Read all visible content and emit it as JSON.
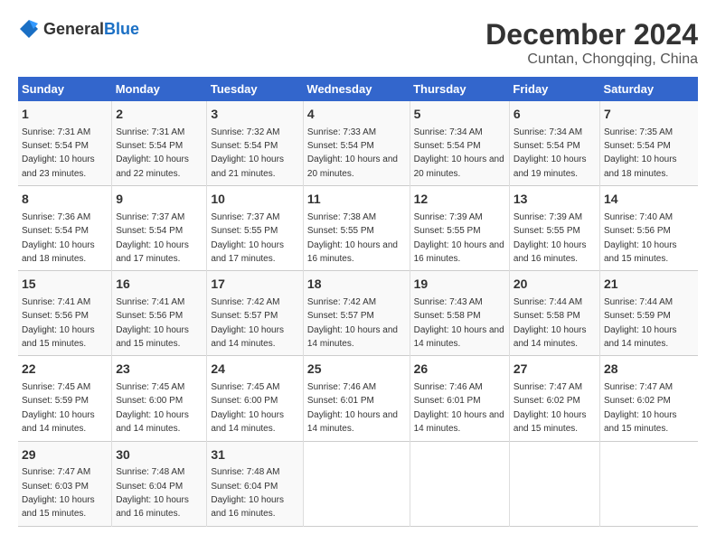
{
  "logo": {
    "general": "General",
    "blue": "Blue"
  },
  "title": "December 2024",
  "subtitle": "Cuntan, Chongqing, China",
  "weekdays": [
    "Sunday",
    "Monday",
    "Tuesday",
    "Wednesday",
    "Thursday",
    "Friday",
    "Saturday"
  ],
  "weeks": [
    [
      {
        "day": "1",
        "sunrise": "7:31 AM",
        "sunset": "5:54 PM",
        "daylight": "10 hours and 23 minutes."
      },
      {
        "day": "2",
        "sunrise": "7:31 AM",
        "sunset": "5:54 PM",
        "daylight": "10 hours and 22 minutes."
      },
      {
        "day": "3",
        "sunrise": "7:32 AM",
        "sunset": "5:54 PM",
        "daylight": "10 hours and 21 minutes."
      },
      {
        "day": "4",
        "sunrise": "7:33 AM",
        "sunset": "5:54 PM",
        "daylight": "10 hours and 20 minutes."
      },
      {
        "day": "5",
        "sunrise": "7:34 AM",
        "sunset": "5:54 PM",
        "daylight": "10 hours and 20 minutes."
      },
      {
        "day": "6",
        "sunrise": "7:34 AM",
        "sunset": "5:54 PM",
        "daylight": "10 hours and 19 minutes."
      },
      {
        "day": "7",
        "sunrise": "7:35 AM",
        "sunset": "5:54 PM",
        "daylight": "10 hours and 18 minutes."
      }
    ],
    [
      {
        "day": "8",
        "sunrise": "7:36 AM",
        "sunset": "5:54 PM",
        "daylight": "10 hours and 18 minutes."
      },
      {
        "day": "9",
        "sunrise": "7:37 AM",
        "sunset": "5:54 PM",
        "daylight": "10 hours and 17 minutes."
      },
      {
        "day": "10",
        "sunrise": "7:37 AM",
        "sunset": "5:55 PM",
        "daylight": "10 hours and 17 minutes."
      },
      {
        "day": "11",
        "sunrise": "7:38 AM",
        "sunset": "5:55 PM",
        "daylight": "10 hours and 16 minutes."
      },
      {
        "day": "12",
        "sunrise": "7:39 AM",
        "sunset": "5:55 PM",
        "daylight": "10 hours and 16 minutes."
      },
      {
        "day": "13",
        "sunrise": "7:39 AM",
        "sunset": "5:55 PM",
        "daylight": "10 hours and 16 minutes."
      },
      {
        "day": "14",
        "sunrise": "7:40 AM",
        "sunset": "5:56 PM",
        "daylight": "10 hours and 15 minutes."
      }
    ],
    [
      {
        "day": "15",
        "sunrise": "7:41 AM",
        "sunset": "5:56 PM",
        "daylight": "10 hours and 15 minutes."
      },
      {
        "day": "16",
        "sunrise": "7:41 AM",
        "sunset": "5:56 PM",
        "daylight": "10 hours and 15 minutes."
      },
      {
        "day": "17",
        "sunrise": "7:42 AM",
        "sunset": "5:57 PM",
        "daylight": "10 hours and 14 minutes."
      },
      {
        "day": "18",
        "sunrise": "7:42 AM",
        "sunset": "5:57 PM",
        "daylight": "10 hours and 14 minutes."
      },
      {
        "day": "19",
        "sunrise": "7:43 AM",
        "sunset": "5:58 PM",
        "daylight": "10 hours and 14 minutes."
      },
      {
        "day": "20",
        "sunrise": "7:44 AM",
        "sunset": "5:58 PM",
        "daylight": "10 hours and 14 minutes."
      },
      {
        "day": "21",
        "sunrise": "7:44 AM",
        "sunset": "5:59 PM",
        "daylight": "10 hours and 14 minutes."
      }
    ],
    [
      {
        "day": "22",
        "sunrise": "7:45 AM",
        "sunset": "5:59 PM",
        "daylight": "10 hours and 14 minutes."
      },
      {
        "day": "23",
        "sunrise": "7:45 AM",
        "sunset": "6:00 PM",
        "daylight": "10 hours and 14 minutes."
      },
      {
        "day": "24",
        "sunrise": "7:45 AM",
        "sunset": "6:00 PM",
        "daylight": "10 hours and 14 minutes."
      },
      {
        "day": "25",
        "sunrise": "7:46 AM",
        "sunset": "6:01 PM",
        "daylight": "10 hours and 14 minutes."
      },
      {
        "day": "26",
        "sunrise": "7:46 AM",
        "sunset": "6:01 PM",
        "daylight": "10 hours and 14 minutes."
      },
      {
        "day": "27",
        "sunrise": "7:47 AM",
        "sunset": "6:02 PM",
        "daylight": "10 hours and 15 minutes."
      },
      {
        "day": "28",
        "sunrise": "7:47 AM",
        "sunset": "6:02 PM",
        "daylight": "10 hours and 15 minutes."
      }
    ],
    [
      {
        "day": "29",
        "sunrise": "7:47 AM",
        "sunset": "6:03 PM",
        "daylight": "10 hours and 15 minutes."
      },
      {
        "day": "30",
        "sunrise": "7:48 AM",
        "sunset": "6:04 PM",
        "daylight": "10 hours and 16 minutes."
      },
      {
        "day": "31",
        "sunrise": "7:48 AM",
        "sunset": "6:04 PM",
        "daylight": "10 hours and 16 minutes."
      },
      null,
      null,
      null,
      null
    ]
  ],
  "labels": {
    "sunrise": "Sunrise:",
    "sunset": "Sunset:",
    "daylight": "Daylight:"
  }
}
